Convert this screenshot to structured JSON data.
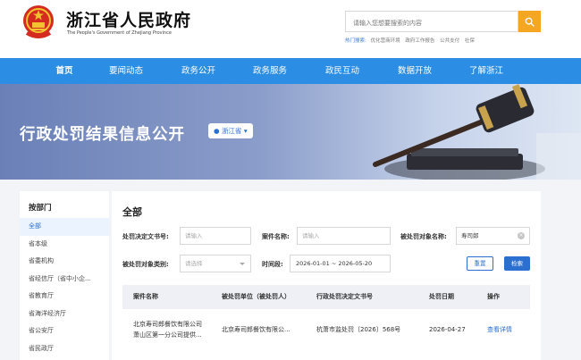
{
  "header": {
    "site_title": "浙江省人民政府",
    "site_subtitle": "The People's Government of Zhejiang Province",
    "search_placeholder": "请输入您想要搜索的内容",
    "hot_label": "热门搜索:",
    "hot_links": [
      "优化营商环境",
      "政府工作报告",
      "公共支付",
      "社保"
    ]
  },
  "nav": {
    "items": [
      "首页",
      "要闻动态",
      "政务公开",
      "政务服务",
      "政民互动",
      "数据开放",
      "了解浙江"
    ],
    "active_index": 0
  },
  "banner": {
    "title": "行政处罚结果信息公开",
    "region": "浙江省"
  },
  "sidebar": {
    "heading": "按部门",
    "items": [
      "全部",
      "省本级",
      "省委机构",
      "省经信厅（省中小企...",
      "省教育厅",
      "省海洋经济厅",
      "省公安厅",
      "省民政厅"
    ],
    "active_index": 0
  },
  "main": {
    "title": "全部",
    "filters": {
      "decision_no_label": "处罚决定文书号:",
      "decision_no_placeholder": "请输入",
      "case_name_label": "案件名称:",
      "case_name_placeholder": "请输入",
      "target_name_label": "被处罚对象名称:",
      "target_name_value": "寿司郎",
      "target_type_label": "被处罚对象类别:",
      "target_type_placeholder": "请选择",
      "time_label": "时间段:",
      "time_value": "2026-01-01 ~ 2026-05-20"
    },
    "reset_label": "重置",
    "search_label": "检索",
    "table": {
      "columns": [
        "案件名称",
        "被处罚单位（被处罚人）",
        "行政处罚决定文书号",
        "处罚日期",
        "操作"
      ],
      "rows": [
        {
          "case_name_line1": "北京寿司郎餐饮有限公司",
          "case_name_line2": "萧山区第一分公司提供...",
          "target": "北京寿司郎餐饮有限公...",
          "decision_no": "杭萧市监处罚〔2026〕568号",
          "date": "2026-04-27",
          "action": "查看详情"
        }
      ]
    }
  },
  "colors": {
    "nav_bg": "#2b8de3",
    "accent": "#2b6fd1",
    "search_button": "#f5a623"
  }
}
